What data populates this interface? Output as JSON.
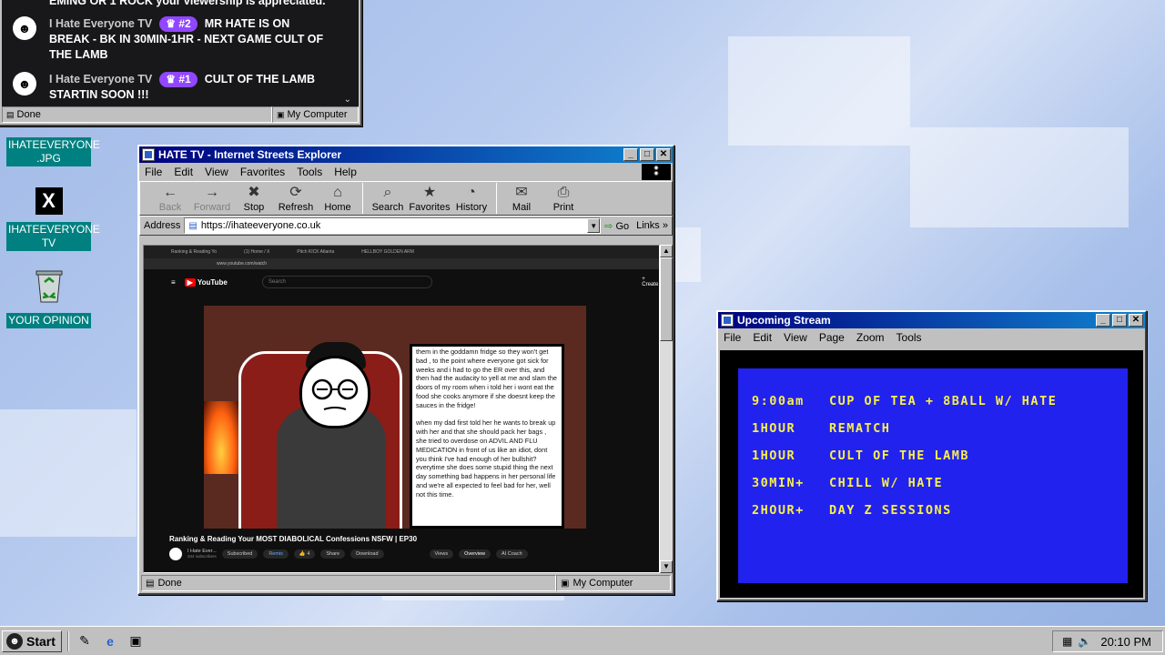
{
  "chat": {
    "msg1_prefix": "EMING OR 1 ROCK your viewership is appreciated.",
    "messages": [
      {
        "user": "I Hate Everyone TV",
        "badge": "#2",
        "text_a": "MR HATE IS ON",
        "text_b": "BREAK - BK IN 30MIN-1HR - NEXT GAME CULT OF",
        "text_c": "THE LAMB"
      },
      {
        "user": "I Hate Everyone TV",
        "badge": "#1",
        "text_a": "CULT OF THE LAMB",
        "text_b": "STARTIN SOON !!!"
      }
    ],
    "status_left": "Done",
    "status_right": "My Computer"
  },
  "desktop": {
    "icons": [
      {
        "label": "IHATEEVERYONE .JPG"
      },
      {
        "label": "IHATEEVERYONE TV"
      },
      {
        "label": "YOUR OPINION"
      }
    ],
    "x_glyph": "X"
  },
  "ie": {
    "title": "HATE TV - Internet Streets Explorer",
    "menu": [
      "File",
      "Edit",
      "View",
      "Favorites",
      "Tools",
      "Help"
    ],
    "toolbar": [
      {
        "label": "Back",
        "glyph": "←"
      },
      {
        "label": "Forward",
        "glyph": "→"
      },
      {
        "label": "Stop",
        "glyph": "✖"
      },
      {
        "label": "Refresh",
        "glyph": "⟳"
      },
      {
        "label": "Home",
        "glyph": "⌂"
      },
      {
        "label": "Search",
        "glyph": "⌕"
      },
      {
        "label": "Favorites",
        "glyph": "★"
      },
      {
        "label": "History",
        "glyph": "◔"
      },
      {
        "label": "Mail",
        "glyph": "✉"
      },
      {
        "label": "Print",
        "glyph": "⎙"
      }
    ],
    "address_label": "Address",
    "address_value": "https://ihateeveryone.co.uk",
    "go_label": "Go",
    "links_label": "Links",
    "status_left": "Done",
    "status_right": "My Computer",
    "youtube": {
      "tabs": [
        "Ranking & Reading Yo",
        "(1) Home / X",
        "Pitch KICK Atlanta",
        "HELLBOY GOLDEN ARM"
      ],
      "url": "www.youtube.com/watch",
      "logo": "YouTube",
      "search_placeholder": "Search",
      "create": "Create",
      "story_text": "them in the goddamn fridge so they won't get bad , to the point where everyone got sick for weeks and i had to go the ER over this, and then had the audacity to yell at me and slam the doors of my room when i told her i wont eat the food she cooks anymore if she doesnt keep the sauces in the fridge!\n\nwhen my dad first told her he wants to break up with her and that she should pack her bags , she tried to overdose on ADVIL AND FLU MEDICATION in front of us like an idiot, dont you think I've had enough of her bullshit? everytime she does some stupid thing the next day something bad happens in her personal life and we're all expected to feel bad for her, well not this time.",
      "video_title": "Ranking & Reading Your MOST DIABOLICAL Confessions NSFW | EP30",
      "channel": "I Hate Ever...",
      "subscribers": "344 subscribers",
      "subscribed": "Subscribed",
      "remix": "Remix",
      "likes": "4",
      "share": "Share",
      "download": "Download",
      "views_tab": "Views",
      "overview_tab": "Overview",
      "ai_tab": "AI Coach"
    }
  },
  "upcoming": {
    "title": "Upcoming Stream",
    "menu": [
      "File",
      "Edit",
      "View",
      "Page",
      "Zoom",
      "Tools"
    ],
    "schedule": [
      {
        "time": "9:00am",
        "event": "CUP OF TEA + 8BALL W/ HATE"
      },
      {
        "time": "1HOUR",
        "event": "REMATCH"
      },
      {
        "time": "1HOUR",
        "event": "CULT OF THE LAMB"
      },
      {
        "time": "30MIN+",
        "event": "CHILL W/ HATE"
      },
      {
        "time": "2HOUR+",
        "event": "DAY Z SESSIONS"
      }
    ]
  },
  "taskbar": {
    "start": "Start",
    "clock": "20:10 PM"
  },
  "colors": {
    "title_start": "#000080",
    "title_end": "#1084d0",
    "schedule_bg": "#2222ee",
    "schedule_text": "#f8f04a",
    "badge": "#9147ff",
    "desktop_label": "#008080"
  }
}
